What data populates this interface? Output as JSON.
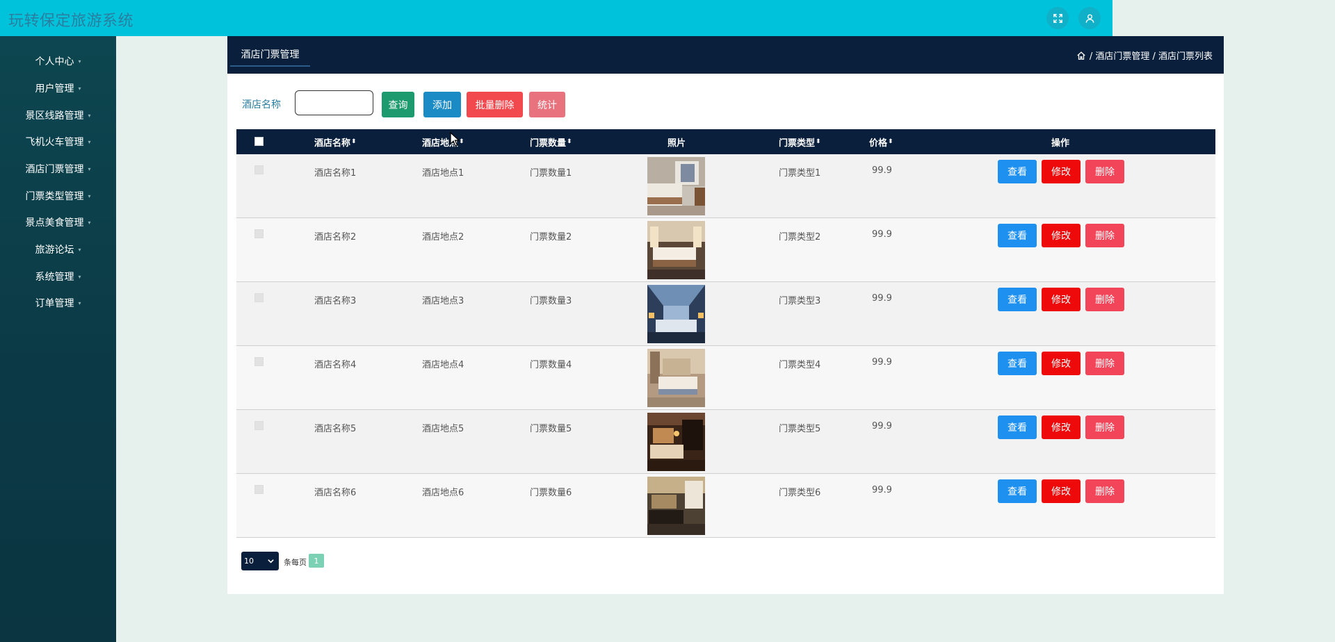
{
  "header": {
    "app_title": "玩转保定旅游系统",
    "fullscreen_icon": "fullscreen-icon",
    "user_icon": "user-icon"
  },
  "sidebar": {
    "items": [
      {
        "label": "个人中心"
      },
      {
        "label": "用户管理"
      },
      {
        "label": "景区线路管理"
      },
      {
        "label": "飞机火车管理"
      },
      {
        "label": "酒店门票管理"
      },
      {
        "label": "门票类型管理"
      },
      {
        "label": "景点美食管理"
      },
      {
        "label": "旅游论坛"
      },
      {
        "label": "系统管理"
      },
      {
        "label": "订单管理"
      }
    ]
  },
  "panel": {
    "tab_label": "酒店门票管理",
    "breadcrumb": {
      "home_icon": "home-icon",
      "text": "/ 酒店门票管理 / 酒店门票列表"
    }
  },
  "search": {
    "label": "酒店名称",
    "value": "",
    "query_label": "查询",
    "add_label": "添加",
    "batch_delete_label": "批量删除",
    "stats_label": "统计"
  },
  "table": {
    "headers": {
      "name": "酒店名称",
      "location": "酒店地点",
      "quantity": "门票数量",
      "photo": "照片",
      "ticket_type": "门票类型",
      "price": "价格",
      "actions": "操作"
    },
    "action_labels": {
      "view": "查看",
      "edit": "修改",
      "delete": "删除"
    },
    "rows": [
      {
        "name": "酒店名称1",
        "location": "酒店地点1",
        "quantity": "门票数量1",
        "ticket_type": "门票类型1",
        "price": "99.9"
      },
      {
        "name": "酒店名称2",
        "location": "酒店地点2",
        "quantity": "门票数量2",
        "ticket_type": "门票类型2",
        "price": "99.9"
      },
      {
        "name": "酒店名称3",
        "location": "酒店地点3",
        "quantity": "门票数量3",
        "ticket_type": "门票类型3",
        "price": "99.9"
      },
      {
        "name": "酒店名称4",
        "location": "酒店地点4",
        "quantity": "门票数量4",
        "ticket_type": "门票类型4",
        "price": "99.9"
      },
      {
        "name": "酒店名称5",
        "location": "酒店地点5",
        "quantity": "门票数量5",
        "ticket_type": "门票类型5",
        "price": "99.9"
      },
      {
        "name": "酒店名称6",
        "location": "酒店地点6",
        "quantity": "门票数量6",
        "ticket_type": "门票类型6",
        "price": "99.9"
      }
    ]
  },
  "pagination": {
    "page_size": "10",
    "per_page_label": "条每页",
    "current_page": "1"
  },
  "colors": {
    "topbar": "#00c3db",
    "sidebar": "#0b3945",
    "panel_head": "#0a1f3c",
    "query_button": "#1e9b6e",
    "add_button": "#1b8bc6",
    "batch_delete_button": "#f2494f",
    "stats_button": "#e8737e",
    "view_button": "#1e90f0",
    "edit_button": "#ee0a0a",
    "delete_button": "#f3455a"
  }
}
